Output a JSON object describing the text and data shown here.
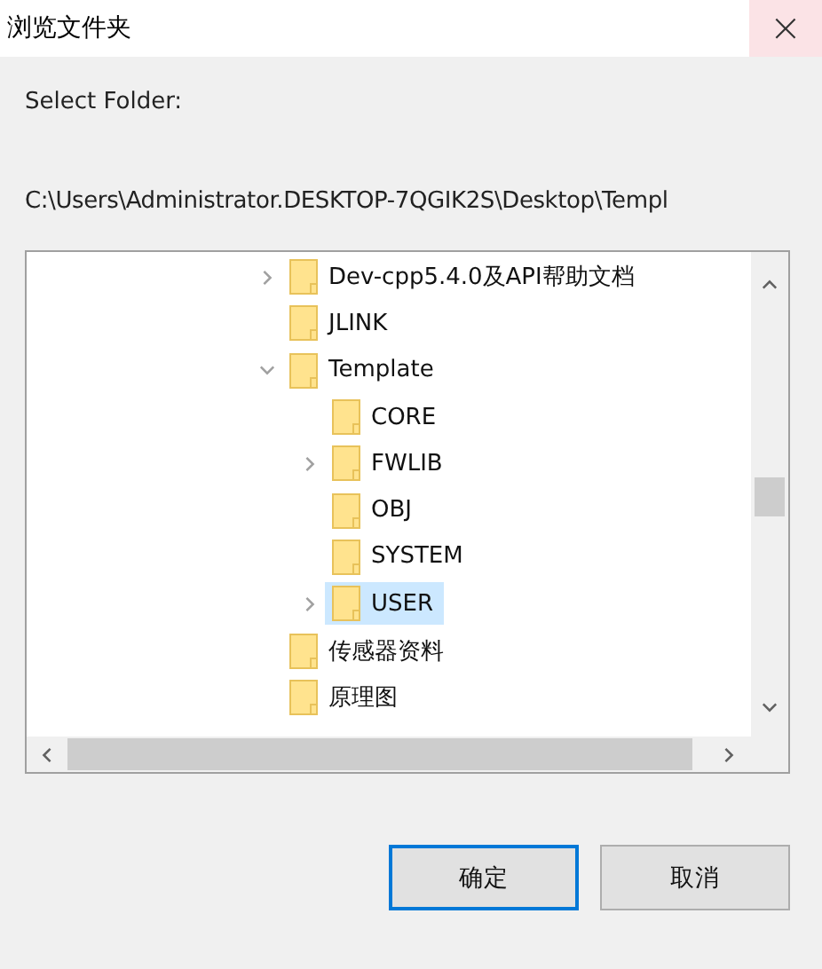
{
  "window": {
    "title": "浏览文件夹",
    "close": "×"
  },
  "prompt": "Select Folder:",
  "path": "C:\\Users\\Administrator.DESKTOP-7QGIK2S\\Desktop\\Templ",
  "tree": [
    {
      "label": "Dev-cpp5.4.0及API帮助文档",
      "kind": "branch",
      "expanded": false,
      "selected": false
    },
    {
      "label": "JLINK",
      "kind": "leaf",
      "selected": false
    },
    {
      "label": "Template",
      "kind": "branch",
      "expanded": true,
      "selected": false,
      "children": [
        {
          "label": "CORE",
          "kind": "leaf",
          "selected": false
        },
        {
          "label": "FWLIB",
          "kind": "branch",
          "expanded": false,
          "selected": false
        },
        {
          "label": "OBJ",
          "kind": "leaf",
          "selected": false
        },
        {
          "label": "SYSTEM",
          "kind": "leaf",
          "selected": false
        },
        {
          "label": "USER",
          "kind": "branch",
          "expanded": false,
          "selected": true
        }
      ]
    },
    {
      "label": "传感器资料",
      "kind": "leaf",
      "selected": false
    },
    {
      "label": "原理图",
      "kind": "leaf",
      "selected": false
    }
  ],
  "buttons": [
    {
      "label": "确定",
      "default": true
    },
    {
      "label": "取消",
      "default": false
    }
  ]
}
